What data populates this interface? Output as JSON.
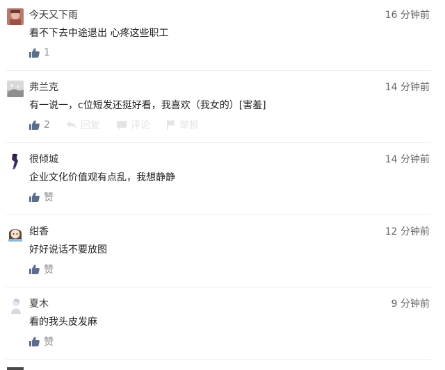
{
  "comments": [
    {
      "username": "今天又下雨",
      "time": "16 分钟前",
      "content": "看不下去中途退出 心疼这些职工",
      "like_label": "1",
      "avatar": "avatar-red-face"
    },
    {
      "username": "弗兰克",
      "time": "14 分钟前",
      "content": "有一说一，c位短发还挺好看，我喜欢（我女的）[害羞]",
      "like_label": "2",
      "reply_label": "回复",
      "comment_label": "评论",
      "report_label": "举报",
      "avatar": "avatar-gray-snow"
    },
    {
      "username": "很倾城",
      "time": "14 分钟前",
      "content": "企业文化价值观有点乱，我想静静",
      "like_label": "赞",
      "avatar": "avatar-dark-figure"
    },
    {
      "username": "绀香",
      "time": "12 分钟前",
      "content": "好好说话不要放图",
      "like_label": "赞",
      "avatar": "avatar-cartoon-girl"
    },
    {
      "username": "夏木",
      "time": "9 分钟前",
      "content": "看的我头皮发麻",
      "like_label": "赞",
      "avatar": "avatar-white-figure"
    }
  ],
  "icons": {
    "like": "thumbs-up-icon",
    "reply": "reply-arrow-icon",
    "comment": "comment-bubble-icon",
    "report": "flag-icon"
  },
  "colors": {
    "text": "#333333",
    "muted": "#8a8a8a",
    "icon": "#5b6e8c",
    "divider": "#eeeeee"
  }
}
